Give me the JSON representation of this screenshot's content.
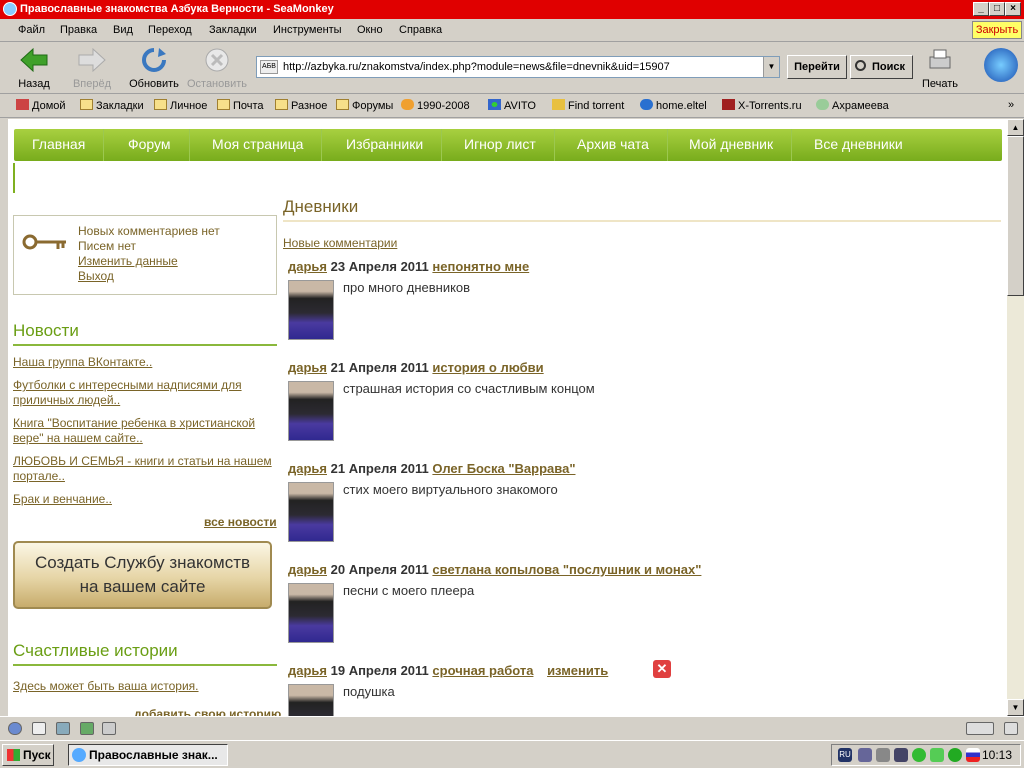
{
  "window": {
    "title": "Православные знакомства Азбука Верности - SeaMonkey",
    "close_label": "Закрыть"
  },
  "menu": [
    "Файл",
    "Правка",
    "Вид",
    "Переход",
    "Закладки",
    "Инструменты",
    "Окно",
    "Справка"
  ],
  "nav": {
    "back": "Назад",
    "forward": "Вперёд",
    "reload": "Обновить",
    "stop": "Остановить",
    "url": "http://azbyka.ru/znakomstva/index.php?module=news&file=dnevnik&uid=15907",
    "site_label": "АБВ",
    "go": "Перейти",
    "search": "Поиск",
    "print": "Печать"
  },
  "bookmarks": [
    "Домой",
    "Закладки",
    "Личное",
    "Почта",
    "Разное",
    "Форумы",
    "1990-2008",
    "AVITO",
    "Find torrent",
    "home.eltel",
    "X-Torrents.ru",
    "Ахрамеева"
  ],
  "site": {
    "topnav": [
      "Главная",
      "Форум",
      "Моя страница",
      "Избранники",
      "Игнор лист",
      "Архив чата",
      "Мой дневник",
      "Все дневники"
    ],
    "login": {
      "comments": "Новых комментариев нет",
      "letters": "Писем нет",
      "edit": "Изменить данные",
      "logout": "Выход"
    },
    "news": {
      "title": "Новости",
      "items": [
        "Наша группа ВКонтакте..",
        "Футболки с интересными надписями для приличных людей..",
        "Книга \"Воспитание ребенка в христианской вере\" на нашем сайте..",
        "ЛЮБОВЬ И СЕМЬЯ - книги и статьи на нашем портале..",
        "Брак и венчание.."
      ],
      "all": "все новости"
    },
    "promo": {
      "line1": "Создать Службу знакомств",
      "line2": "на вашем сайте"
    },
    "stories": {
      "title": "Счастливые истории",
      "link": "Здесь может быть ваша история.",
      "add": "добавить свою историю"
    },
    "main": {
      "title": "Дневники",
      "new_comments": "Новые комментарии"
    },
    "entries": [
      {
        "author": "дарья",
        "date": "23 Апреля 2011",
        "title": "непонятно мне",
        "text": "про много дневников"
      },
      {
        "author": "дарья",
        "date": "21 Апреля 2011",
        "title": "история о любви",
        "text": "страшная история со счастливым концом"
      },
      {
        "author": "дарья",
        "date": "21 Апреля 2011",
        "title": "Олег Боска \"Варрава\"",
        "text": "стих моего виртуального знакомого"
      },
      {
        "author": "дарья",
        "date": "20 Апреля 2011",
        "title": "светлана копылова \"послушник и монах\"",
        "text": "песни с моего плеера"
      },
      {
        "author": "дарья",
        "date": "19 Апреля 2011",
        "title": "срочная работа",
        "edit": "изменить",
        "text": "подушка"
      }
    ]
  },
  "taskbar": {
    "start": "Пуск",
    "item": "Православные знак...",
    "lang": "RU",
    "clock": "10:13"
  }
}
